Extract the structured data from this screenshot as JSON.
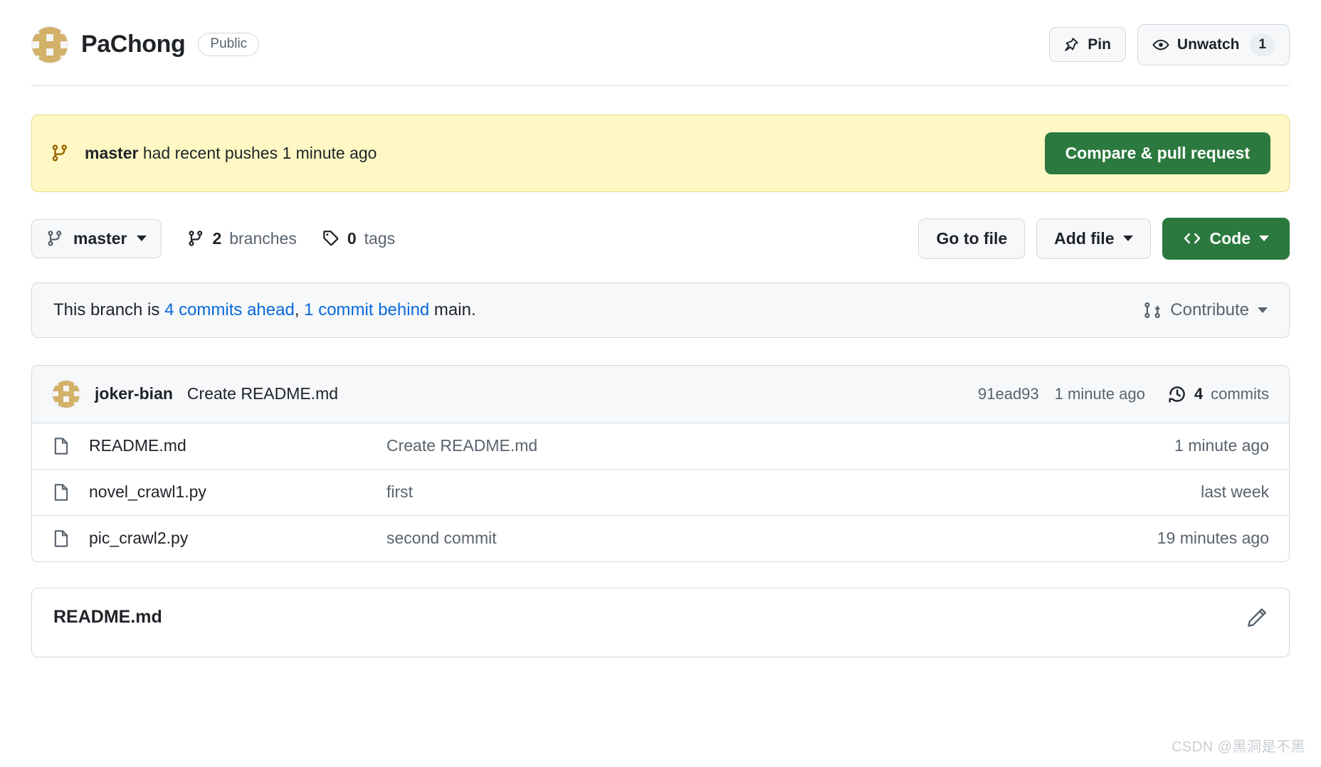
{
  "repo": {
    "name": "PaChong",
    "visibility": "Public",
    "avatar_icon": "identicon-avatar",
    "avatar_pattern": [
      0,
      1,
      1,
      1,
      0,
      1,
      1,
      0,
      1,
      1,
      0,
      1,
      1,
      1,
      0,
      1,
      1,
      0,
      1,
      1,
      0,
      1,
      1,
      1,
      0
    ]
  },
  "header_actions": {
    "pin": {
      "label": "Pin",
      "icon": "pin-icon"
    },
    "unwatch": {
      "label": "Unwatch",
      "icon": "eye-icon",
      "count": "1"
    }
  },
  "push_banner": {
    "branch_icon": "git-branch-icon",
    "branch": "master",
    "text": " had recent pushes 1 minute ago",
    "cta": "Compare & pull request"
  },
  "branch_bar": {
    "branch_selector": {
      "label": "master",
      "icon": "git-branch-icon"
    },
    "branches": {
      "count": "2",
      "label": "branches",
      "icon": "git-branch-icon"
    },
    "tags": {
      "count": "0",
      "label": "tags",
      "icon": "tag-icon"
    },
    "go_to_file": "Go to file",
    "add_file": "Add file",
    "code": {
      "label": "Code",
      "icon": "code-icon"
    }
  },
  "compare": {
    "prefix": "This branch is ",
    "ahead": "4 commits ahead",
    "separator": ", ",
    "behind": "1 commit behind",
    "suffix": " main.",
    "contribute": {
      "label": "Contribute",
      "icon": "git-pull-request-icon"
    }
  },
  "latest_commit": {
    "author": "joker-bian",
    "message": "Create README.md",
    "sha": "91ead93",
    "date": "1 minute ago",
    "commits_count": "4",
    "commits_label": "commits",
    "history_icon": "history-icon"
  },
  "files": [
    {
      "icon": "file-icon",
      "name": "README.md",
      "message": "Create README.md",
      "time": "1 minute ago"
    },
    {
      "icon": "file-icon",
      "name": "novel_crawl1.py",
      "message": "first",
      "time": "last week"
    },
    {
      "icon": "file-icon",
      "name": "pic_crawl2.py",
      "message": "second commit",
      "time": "19 minutes ago"
    }
  ],
  "readme": {
    "title": "README.md",
    "edit_icon": "pencil-icon"
  },
  "watermark": "CSDN @黑洞是不黑",
  "colors": {
    "green": "#2c793f",
    "link": "#0969da",
    "banner_bg": "#fff8c5",
    "banner_border": "#e6d98a",
    "muted": "#59636e",
    "border": "#d1d9e0",
    "avatar_block": "#d3b169"
  }
}
